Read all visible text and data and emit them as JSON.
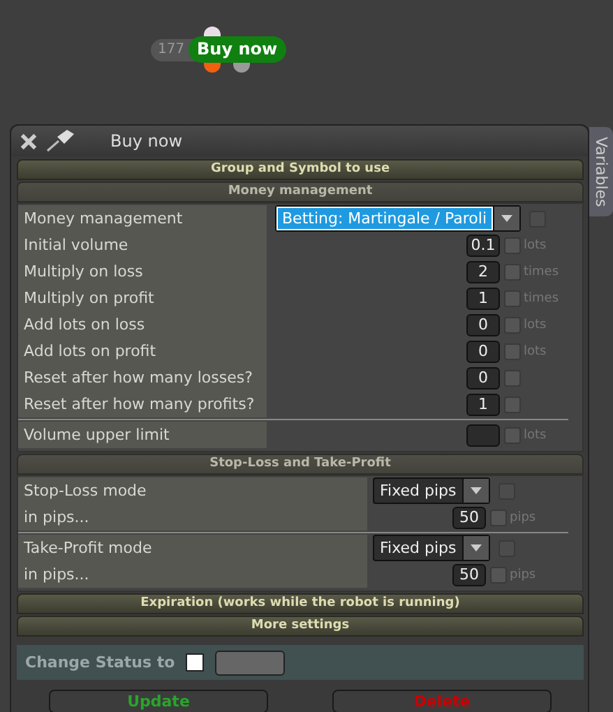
{
  "node": {
    "count": "177",
    "label": "Buy now"
  },
  "window": {
    "title": "Buy now",
    "side_tab": "Variables"
  },
  "sections": [
    {
      "title": "Group and Symbol to use",
      "expanded": false
    },
    {
      "title": "Money management",
      "expanded": true,
      "groups": [
        [
          {
            "kind": "select",
            "label": "Money management",
            "value": "Betting: Martingale / Paroli",
            "focused": true,
            "checkbox_disabled": true
          },
          {
            "kind": "number",
            "label": "Initial volume",
            "value": "0.1",
            "unit": "lots",
            "checked": false
          },
          {
            "kind": "number",
            "label": "Multiply on loss",
            "value": "2",
            "unit": "times",
            "checked": false
          },
          {
            "kind": "number",
            "label": "Multiply on profit",
            "value": "1",
            "unit": "times",
            "checked": false
          },
          {
            "kind": "number",
            "label": "Add lots on loss",
            "value": "0",
            "unit": "lots",
            "checked": false
          },
          {
            "kind": "number",
            "label": "Add lots on profit",
            "value": "0",
            "unit": "lots",
            "checked": false
          },
          {
            "kind": "number",
            "label": "Reset after how many losses?",
            "value": "0",
            "checked": false
          },
          {
            "kind": "number",
            "label": "Reset after how many profits?",
            "value": "1",
            "checked": false
          }
        ],
        [
          {
            "kind": "number",
            "label": "Volume upper limit",
            "unit": "lots",
            "checked": false
          }
        ]
      ]
    },
    {
      "title": "Stop-Loss and Take-Profit",
      "expanded": true,
      "groups": [
        [
          {
            "kind": "select",
            "label": "Stop-Loss mode",
            "value": "Fixed pips",
            "focused": false,
            "checkbox_disabled": true
          },
          {
            "kind": "number",
            "label": "in pips...",
            "value": "50",
            "unit": "pips",
            "checked": false
          }
        ],
        [
          {
            "kind": "select",
            "label": "Take-Profit mode",
            "value": "Fixed pips",
            "focused": false,
            "checkbox_disabled": true
          },
          {
            "kind": "number",
            "label": "in pips...",
            "value": "50",
            "unit": "pips",
            "checked": false
          }
        ]
      ]
    },
    {
      "title": "Expiration (works while the robot is running)",
      "expanded": false
    },
    {
      "title": "More settings",
      "expanded": false
    }
  ],
  "status": {
    "label": "Change Status to"
  },
  "buttons": [
    {
      "label": "Update",
      "kind": "ok"
    },
    {
      "label": "Delete",
      "kind": "danger"
    }
  ]
}
